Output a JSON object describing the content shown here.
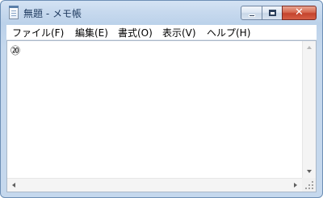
{
  "window": {
    "title": "無題 - メモ帳",
    "close_glyph": "✕"
  },
  "menu": {
    "items": [
      {
        "label": "ファイル(F)"
      },
      {
        "label": "編集(E)"
      },
      {
        "label": "書式(O)"
      },
      {
        "label": "表示(V)"
      },
      {
        "label": "ヘルプ(H)"
      }
    ]
  },
  "editor": {
    "content": "⑳"
  },
  "icons": {
    "app": "notepad-icon",
    "minimize": "minimize-icon",
    "maximize": "maximize-icon",
    "close": "close-icon"
  },
  "colors": {
    "titlebar": "#c7d9ee",
    "close_button": "#c4432d",
    "window_border": "#6d8fb5"
  }
}
